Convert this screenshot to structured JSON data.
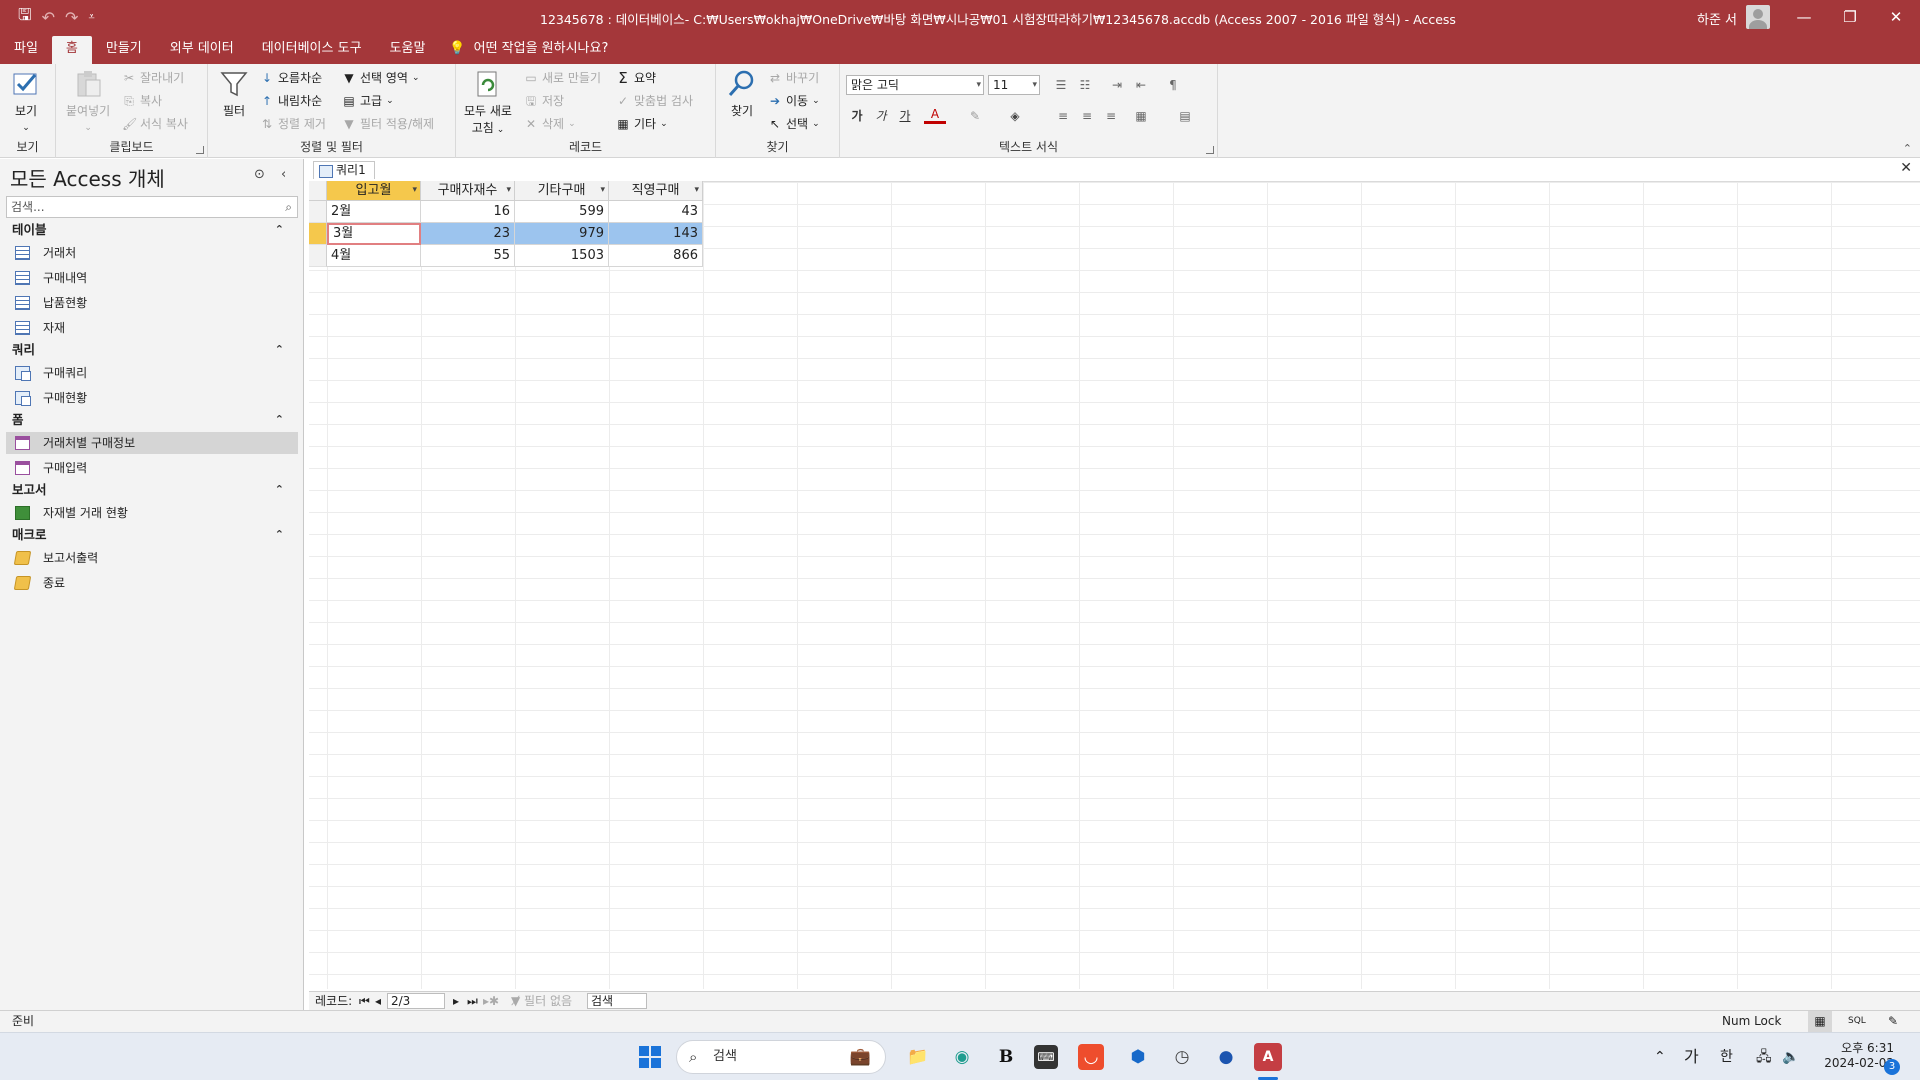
{
  "window": {
    "title": "12345678 : 데이터베이스- C:₩Users₩okhaj₩OneDrive₩바탕 화면₩시나공₩01 시험장따라하기₩12345678.accdb (Access 2007 - 2016 파일 형식)  -  Access",
    "user": "하준 서",
    "controls": [
      "—",
      "❐",
      "✕"
    ]
  },
  "ribbon_tabs": [
    "파일",
    "홈",
    "만들기",
    "외부 데이터",
    "데이터베이스 도구",
    "도움말"
  ],
  "tell_me": "어떤 작업을 원하시나요?",
  "ribbon": {
    "view": {
      "label": "보기",
      "group": "보기"
    },
    "clipboard": {
      "paste": "붙여넣기",
      "cut": "잘라내기",
      "copy": "복사",
      "format_painter": "서식 복사",
      "group": "클립보드"
    },
    "sort_filter": {
      "filter": "필터",
      "ascending": "오름차순",
      "descending": "내림차순",
      "remove_sort": "정렬 제거",
      "selection": "선택 영역",
      "advanced": "고급",
      "toggle_filter": "필터 적용/해제",
      "group": "정렬 및 필터"
    },
    "records": {
      "refresh": "모두 새로",
      "refresh2": "고침",
      "new": "새로 만들기",
      "save": "저장",
      "delete": "삭제",
      "totals": "요약",
      "spelling": "맞춤법 검사",
      "more": "기타",
      "group": "레코드"
    },
    "find": {
      "find": "찾기",
      "replace": "바꾸기",
      "goto": "이동",
      "select": "선택",
      "group": "찾기"
    },
    "text_format": {
      "font": "맑은 고딕",
      "size": "11",
      "bold": "가",
      "italic": "가",
      "underline": "가",
      "group": "텍스트 서식"
    }
  },
  "nav": {
    "title": "모든 Access 개체",
    "search_placeholder": "검색...",
    "sections": [
      {
        "name": "테이블",
        "items": [
          "거래처",
          "구매내역",
          "납품현황",
          "자재"
        ]
      },
      {
        "name": "쿼리",
        "items": [
          "구매쿼리",
          "구매현황"
        ]
      },
      {
        "name": "폼",
        "items": [
          "거래처별 구매정보",
          "구매입력"
        ]
      },
      {
        "name": "보고서",
        "items": [
          "자재별 거래 현황"
        ]
      },
      {
        "name": "매크로",
        "items": [
          "보고서출력",
          "종료"
        ]
      }
    ],
    "selected": "거래처별 구매정보"
  },
  "document": {
    "tab": "쿼리1",
    "columns": [
      "입고월",
      "구매자재수",
      "기타구매",
      "직영구매"
    ],
    "rows": [
      [
        "2월",
        "16",
        "599",
        "43"
      ],
      [
        "3월",
        "23",
        "979",
        "143"
      ],
      [
        "4월",
        "55",
        "1503",
        "866"
      ]
    ],
    "current_row": 1
  },
  "record_nav": {
    "label": "레코드:",
    "position": "2/3",
    "no_filter": "필터 없음",
    "search": "검색"
  },
  "status": {
    "left": "준비",
    "numlock": "Num Lock"
  },
  "taskbar": {
    "search": "검색",
    "ime1": "가",
    "ime2": "한",
    "time": "오후 6:31",
    "date": "2024-02-02",
    "badge": "3"
  }
}
